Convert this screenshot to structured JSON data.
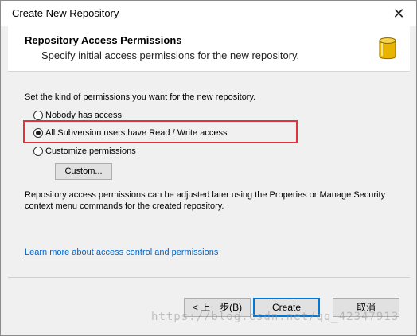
{
  "window": {
    "title": "Create New Repository",
    "close_glyph": "✕"
  },
  "header": {
    "title": "Repository Access Permissions",
    "subtitle": "Specify initial access permissions for the new repository.",
    "icon": "database-icon"
  },
  "body": {
    "intro": "Set the kind of permissions you want for the new repository.",
    "options": [
      {
        "label": "Nobody has access",
        "checked": false
      },
      {
        "label": "All Subversion users have Read / Write access",
        "checked": true
      },
      {
        "label": "Customize permissions",
        "checked": false
      }
    ],
    "custom_button": "Custom...",
    "description": "Repository access permissions can be adjusted later using the Properies or Manage Security context menu commands for the created repository.",
    "learn_more_link": "Learn more about access control and permissions"
  },
  "footer": {
    "back_label": "< 上一步(B)",
    "create_label": "Create",
    "cancel_label": "取消"
  },
  "watermark": "https://blog.csdn.net/qq_42347913",
  "colors": {
    "highlight": "#e2333b",
    "link": "#0066cc",
    "default_button_border": "#0078d7"
  }
}
